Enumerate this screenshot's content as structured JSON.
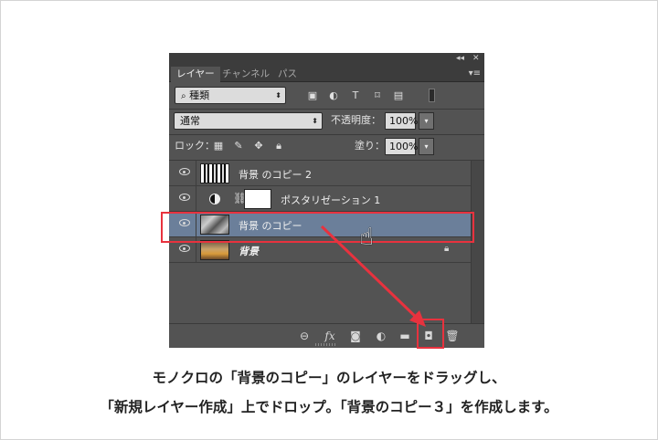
{
  "panel": {
    "tabs": [
      "レイヤー",
      "チャンネル",
      "パス"
    ],
    "window_controls": {
      "collapse": "◂◂",
      "close": "✕"
    },
    "panel_menu": "▾≡",
    "filter": {
      "kind_label": "種類"
    },
    "blend_mode": "通常",
    "opacity_label": "不透明度：",
    "opacity_value": "100%",
    "lock_label": "ロック：",
    "fill_label": "塗り：",
    "fill_value": "100%",
    "layers": [
      {
        "name": "背景 のコピー 2",
        "thumb": "bw",
        "visible": true
      },
      {
        "name": "ポスタリゼーション 1",
        "thumb": "adjustment",
        "visible": true
      },
      {
        "name": "背景 のコピー",
        "thumb": "gray",
        "visible": true,
        "selected": true
      },
      {
        "name": "背景",
        "thumb": "color",
        "visible": true,
        "locked": true
      }
    ]
  },
  "caption": {
    "line1": "モノクロの「背景のコピー」のレイヤーをドラッグし、",
    "line2": "「新規レイヤー作成」上でドロップ。「背景のコピー３」を作成します。"
  },
  "colors": {
    "panel_bg": "#535353",
    "selected_row": "#6b7f9a",
    "highlight": "#e8323e"
  }
}
